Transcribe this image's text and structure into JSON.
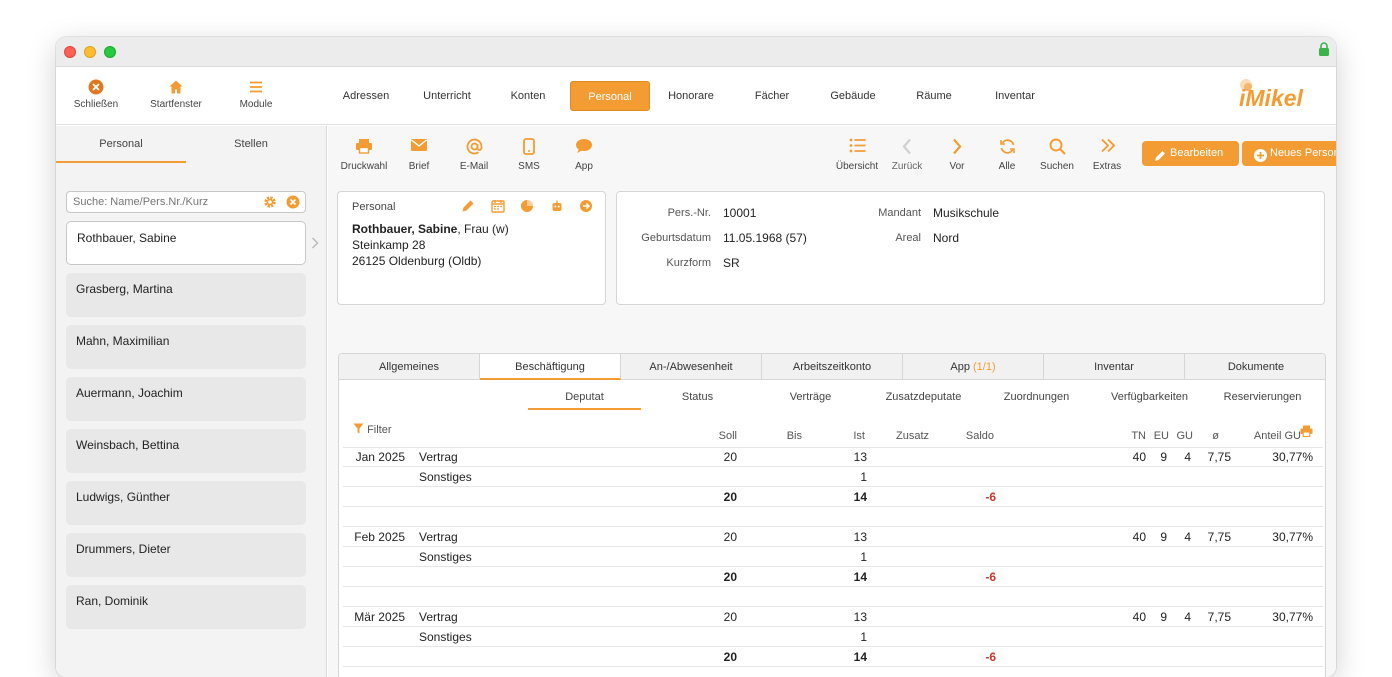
{
  "toolbar": {
    "close_label": "Schließen",
    "home_label": "Startfenster",
    "modules_label": "Module"
  },
  "nav_tabs": [
    "Adressen",
    "Unterricht",
    "Konten",
    "Personal",
    "Honorare",
    "Fächer",
    "Gebäude",
    "Räume",
    "Inventar"
  ],
  "logo_text": "iMikel",
  "sidebar": {
    "tabs": [
      "Personal",
      "Stellen"
    ],
    "search_placeholder": "Suche: Name/Pers.Nr./Kurz",
    "persons": [
      "Rothbauer, Sabine",
      "Grasberg, Martina",
      "Mahn, Maximilian",
      "Auermann, Joachim",
      "Weinsbach, Bettina",
      "Ludwigs, Günther",
      "Drummers, Dieter",
      "Ran, Dominik"
    ]
  },
  "actions": {
    "print": "Druckwahl",
    "letter": "Brief",
    "email": "E-Mail",
    "sms": "SMS",
    "app": "App",
    "overview": "Übersicht",
    "back": "Zurück",
    "forward": "Vor",
    "all": "Alle",
    "search": "Suchen",
    "extras": "Extras",
    "edit": "Bearbeiten",
    "new": "Neues Personal"
  },
  "person": {
    "section_title": "Personal",
    "name_bold": "Rothbauer, Sabine",
    "name_rest": ", Frau (w)",
    "street": "Steinkamp 28",
    "city": "26125 Oldenburg (Oldb)"
  },
  "details": {
    "persnr_label": "Pers.-Nr.",
    "persnr": "10001",
    "birth_label": "Geburtsdatum",
    "birth": "11.05.1968 (57)",
    "short_label": "Kurzform",
    "short": "SR",
    "client_label": "Mandant",
    "client": "Musikschule",
    "area_label": "Areal",
    "area": "Nord"
  },
  "main_tabs": [
    "Allgemeines",
    "Beschäftigung",
    "An-/Abwesenheit",
    "Arbeitszeitkonto",
    "App",
    "Inventar",
    "Dokumente"
  ],
  "app_count": "(1/1)",
  "sub_tabs": [
    "Deputat",
    "Status",
    "Verträge",
    "Zusatzdeputate",
    "Zuordnungen",
    "Verfügbarkeiten",
    "Reservierungen"
  ],
  "filter_label": "Filter",
  "headers": {
    "soll": "Soll",
    "bis": "Bis",
    "ist": "Ist",
    "zusatz": "Zusatz",
    "saldo": "Saldo",
    "tn": "TN",
    "eu": "EU",
    "gu": "GU",
    "avg": "ø",
    "anteil": "Anteil GU"
  },
  "months": [
    {
      "month": "Jan 2025",
      "vertrag_label": "Vertrag",
      "vertrag_soll": "20",
      "vertrag_ist": "13",
      "tn": "40",
      "eu": "9",
      "gu": "4",
      "avg": "7,75",
      "anteil": "30,77%",
      "sonst_label": "Sonstiges",
      "sonst_ist": "1",
      "sum_soll": "20",
      "sum_ist": "14",
      "sum_saldo": "-6"
    },
    {
      "month": "Feb 2025",
      "vertrag_label": "Vertrag",
      "vertrag_soll": "20",
      "vertrag_ist": "13",
      "tn": "40",
      "eu": "9",
      "gu": "4",
      "avg": "7,75",
      "anteil": "30,77%",
      "sonst_label": "Sonstiges",
      "sonst_ist": "1",
      "sum_soll": "20",
      "sum_ist": "14",
      "sum_saldo": "-6"
    },
    {
      "month": "Mär 2025",
      "vertrag_label": "Vertrag",
      "vertrag_soll": "20",
      "vertrag_ist": "13",
      "tn": "40",
      "eu": "9",
      "gu": "4",
      "avg": "7,75",
      "anteil": "30,77%",
      "sonst_label": "Sonstiges",
      "sonst_ist": "1",
      "sum_soll": "20",
      "sum_ist": "14",
      "sum_saldo": "-6"
    }
  ],
  "colors": {
    "accent": "#f39c33",
    "negative": "#c0392b"
  }
}
